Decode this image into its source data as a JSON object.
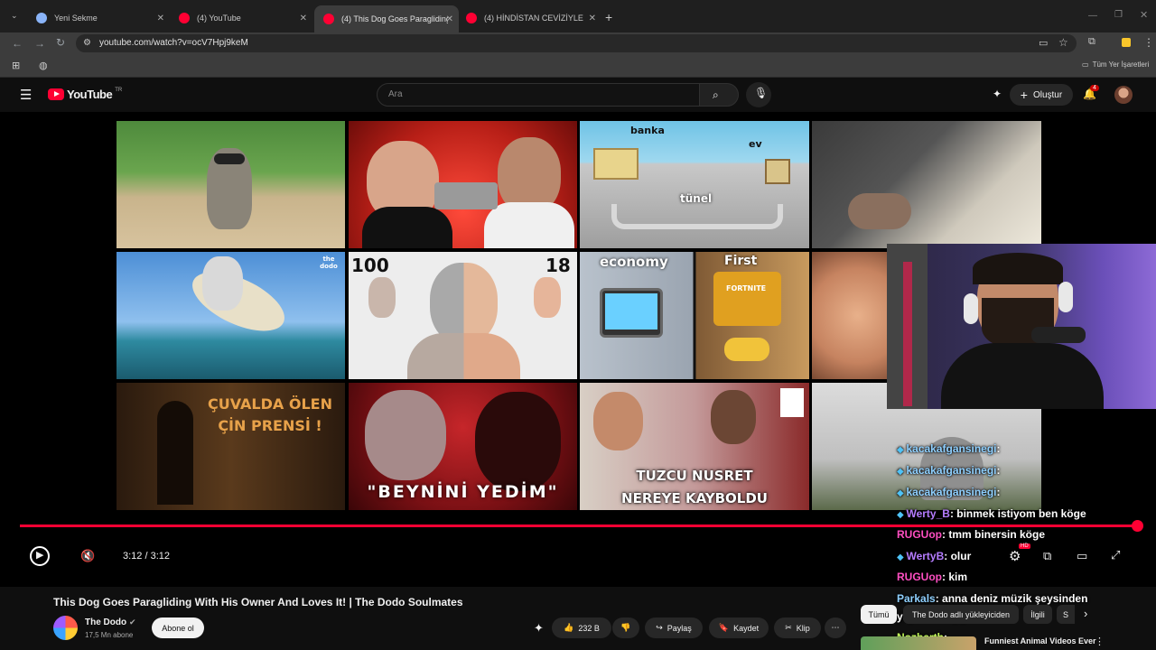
{
  "browser": {
    "tabs": [
      {
        "title": "Yeni Sekme"
      },
      {
        "title": "(4) YouTube"
      },
      {
        "title": "(4) This Dog Goes Paragliding W"
      },
      {
        "title": "(4) HİNDİSTAN CEVİZİYLE HAPİ"
      }
    ],
    "new_tab": "+",
    "url": "youtube.com/watch?v=ocV7Hpj9keM",
    "bookmarks_all": "Tüm Yer İşaretleri"
  },
  "youtube": {
    "logo": "YouTube",
    "country": "TR",
    "search_placeholder": "Ara",
    "create_label": "Oluştur",
    "notif_count": "4"
  },
  "endscreen": {
    "t2_left": "banka",
    "t2_right": "ev",
    "t2_bottom": "tünel",
    "t5_badge": "the dodo",
    "t6_left": "100",
    "t6_right": "18",
    "t7_left": "economy",
    "t7_right": "First",
    "t7_game": "FORTNITE",
    "t9_text": "ÇUVALDA ÖLEN ÇİN PRENSİ !",
    "t10_text": "\"BEYNİNİ YEDİM\"",
    "t11_line1": "TUZCU NUSRET",
    "t11_line2": "NEREYE KAYBOLDU"
  },
  "player": {
    "time": "3:12 / 3:12",
    "progress": 1.0,
    "hd_badge": "HD"
  },
  "video": {
    "title": "This Dog Goes Paragliding With His Owner And Loves It! | The Dodo Soulmates",
    "channel": "The Dodo",
    "subscribers": "17,5 Mn abone",
    "subscribe_label": "Abone ol",
    "likes": "232 B",
    "share_label": "Paylaş",
    "save_label": "Kaydet",
    "clip_label": "Klip"
  },
  "related": {
    "chip_all": "Tümü",
    "chip_uploader": "The Dodo adlı yükleyiciden",
    "chip_related": "İlgili",
    "chip_more": "S",
    "next_title": "Funniest Animal Videos Ever"
  },
  "chat": [
    {
      "user": "kacakafgansinegi",
      "msg": ":",
      "color": "#8fd0ff"
    },
    {
      "user": "kacakafgansinegi",
      "msg": ":",
      "color": "#8fd0ff"
    },
    {
      "user": "kacakafgansinegi",
      "msg": ":",
      "color": "#8fd0ff"
    },
    {
      "user": "Werty_B",
      "msg": ": binmek istiyom ben köge",
      "color": "#b57cff"
    },
    {
      "user": "RUGUop",
      "msg": ": tmm binersin köge",
      "color": "#ff4fc2"
    },
    {
      "user": "WertyB",
      "msg": ": olur",
      "color": "#b57cff"
    },
    {
      "user": "RUGUop",
      "msg": ": kim",
      "color": "#ff4fc2"
    },
    {
      "user": "Parkals",
      "msg": ": anna deniz müzik şeysinden",
      "color": "#8fd0ff"
    },
    {
      "user": "",
      "msg": "yapacakmış yine",
      "color": "#ffffff"
    },
    {
      "user": "Nozbarth",
      "msg": ":",
      "color": "#c6ff5b"
    }
  ]
}
